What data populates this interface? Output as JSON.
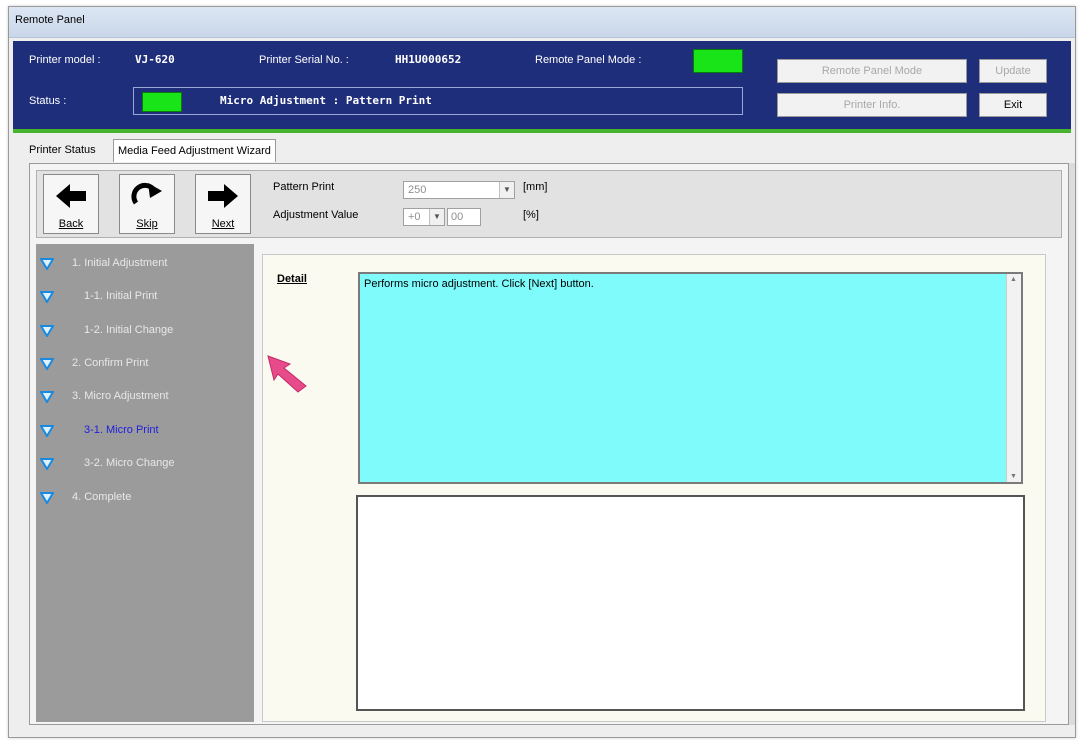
{
  "window": {
    "title": "Remote Panel"
  },
  "header": {
    "printer_model_label": "Printer model :",
    "printer_model_value": "VJ-620",
    "serial_label": "Printer Serial No. :",
    "serial_value": "HH1U000652",
    "remote_mode_label": "Remote Panel Mode :",
    "status_label": "Status :",
    "status_text": "Micro Adjustment : Pattern Print",
    "buttons": {
      "remote_panel_mode": "Remote Panel Mode",
      "update": "Update",
      "printer_info": "Printer Info.",
      "exit": "Exit"
    },
    "lamp_color": "#18e418"
  },
  "tabs": [
    {
      "label": "Printer Status"
    },
    {
      "label": "Media Feed Adjustment Wizard"
    }
  ],
  "toolbar": {
    "back_label": "Back",
    "skip_label": "Skip",
    "next_label": "Next",
    "pattern_print_label": "Pattern Print",
    "pattern_print_value": "250",
    "pattern_print_unit": "[mm]",
    "adjustment_label": "Adjustment Value",
    "adjustment_sign": "+0",
    "adjustment_decimal": "00",
    "adjustment_unit": "[%]"
  },
  "steps": [
    {
      "label": "1. Initial Adjustment"
    },
    {
      "label": "1-1.  Initial Print"
    },
    {
      "label": "1-2.  Initial Change"
    },
    {
      "label": "2. Confirm Print"
    },
    {
      "label": "3. Micro Adjustment"
    },
    {
      "label": "3-1.  Micro Print"
    },
    {
      "label": "3-2.   Micro Change"
    },
    {
      "label": "4. Complete"
    }
  ],
  "detail": {
    "label": "Detail",
    "text": "Performs micro adjustment. Click [Next] button.",
    "background_color": "#80fbfb"
  }
}
